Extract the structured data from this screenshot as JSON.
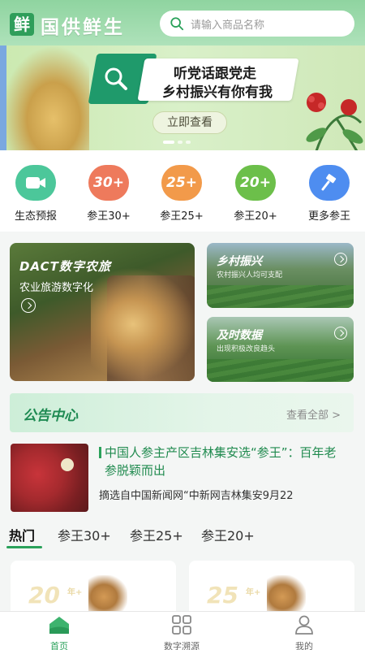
{
  "header": {
    "logo_char": "鲜",
    "app_name": "国供鲜生",
    "search_placeholder": "请输入商品名称"
  },
  "banner": {
    "line1": "听党话跟党走",
    "line2": "乡村振兴有你有我",
    "button": "立即查看"
  },
  "categories": [
    {
      "label": "生态预报",
      "badge": "",
      "color": "#4cc79a",
      "icon": "video-camera-icon"
    },
    {
      "label": "参王30+",
      "badge": "30+",
      "color": "#ee7a5c",
      "icon": "badge-30-icon"
    },
    {
      "label": "参王25+",
      "badge": "25+",
      "color": "#f29a4a",
      "icon": "badge-25-icon"
    },
    {
      "label": "参王20+",
      "badge": "20+",
      "color": "#6cbf4a",
      "icon": "badge-20-icon"
    },
    {
      "label": "更多参王",
      "badge": "",
      "color": "#4e8df0",
      "icon": "hammer-icon"
    }
  ],
  "features": {
    "main": {
      "title": "DACT数字农旅",
      "subtitle": "农业旅游数字化"
    },
    "card1": {
      "title": "乡村振兴",
      "subtitle": "农村振兴人均可支配"
    },
    "card2": {
      "title": "及时数据",
      "subtitle": "出现积极改良趋头"
    }
  },
  "notice": {
    "title": "公告中心",
    "more": "查看全部 >",
    "item": {
      "title": "中国人参主产区吉林集安选“参王”：百年老参脱颖而出",
      "source": "摘选自中国新闻网“中新网吉林集安9月22"
    }
  },
  "tabs": [
    "热门",
    "参王30+",
    "参王25+",
    "参王20+"
  ],
  "products": [
    {
      "badge": "20",
      "plus": "年+"
    },
    {
      "badge": "25",
      "plus": "年+"
    }
  ],
  "nav": [
    {
      "label": "首页",
      "icon": "home-icon",
      "active": true
    },
    {
      "label": "数字溯源",
      "icon": "grid-icon",
      "active": false
    },
    {
      "label": "我的",
      "icon": "user-icon",
      "active": false
    }
  ],
  "colors": {
    "brand_green": "#2aa15a",
    "tab_underline": "#2aa15a"
  }
}
